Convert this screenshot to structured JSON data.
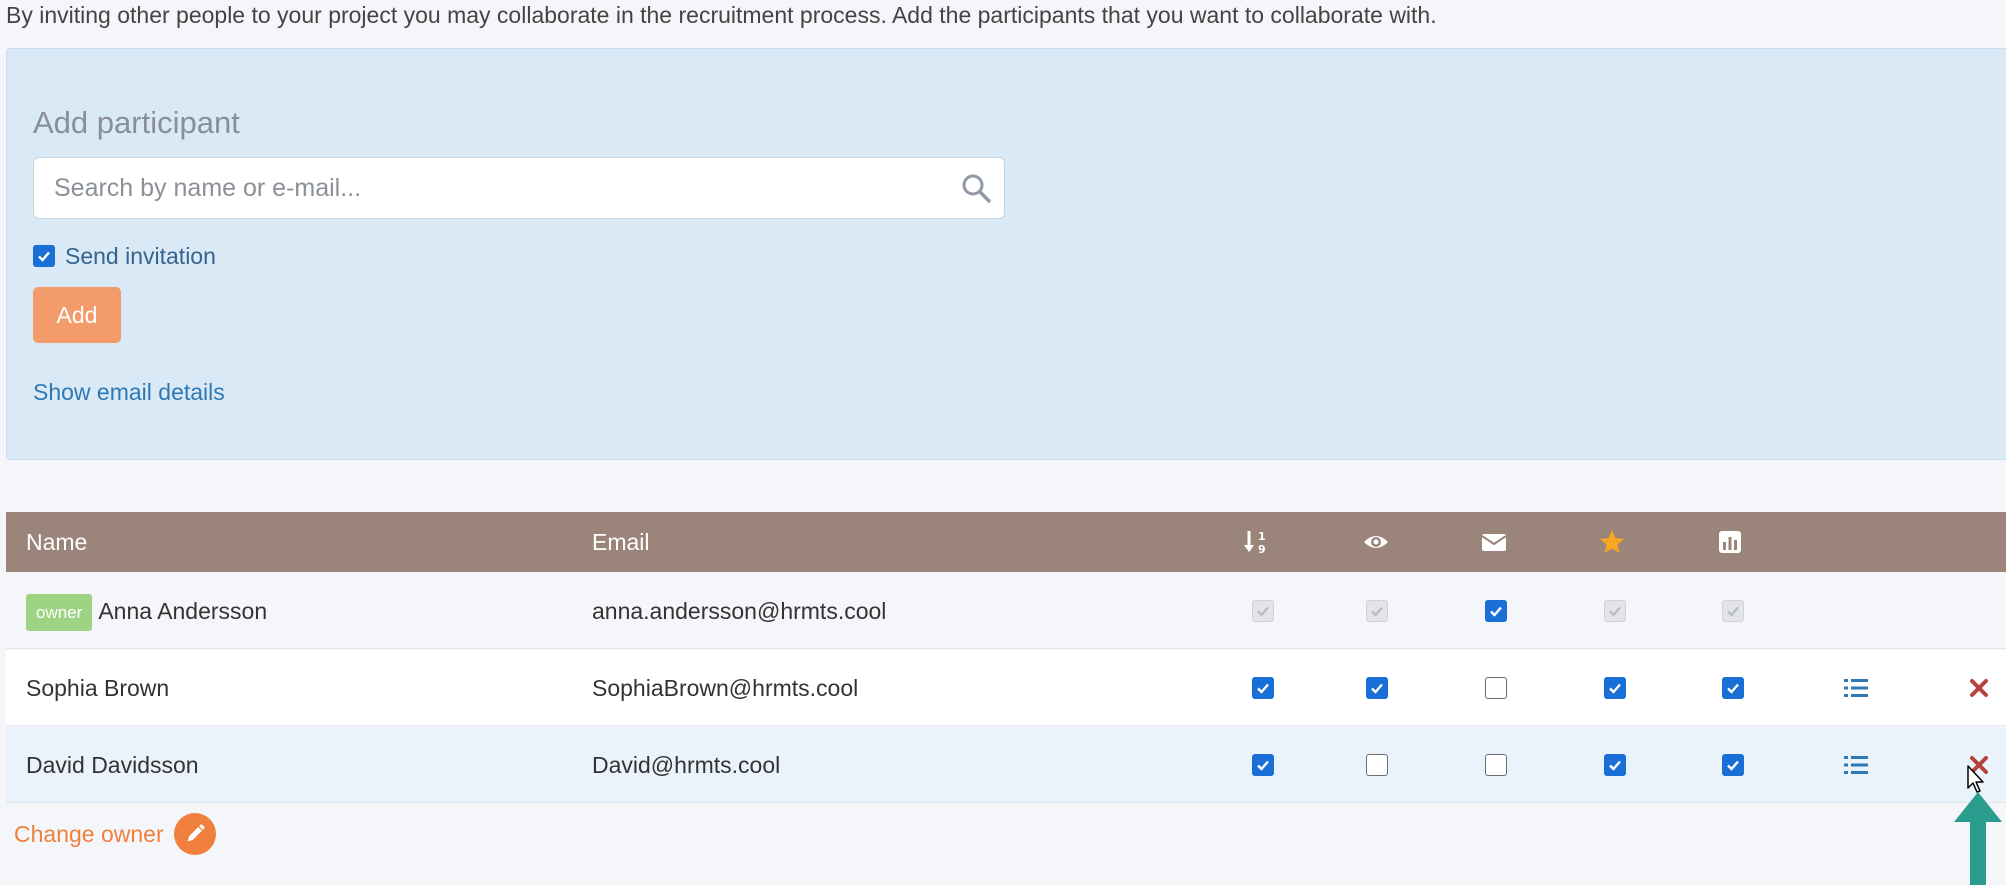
{
  "intro_text": "By inviting other people to your project you may collaborate in the recruitment process. Add the participants that you want to collaborate with.",
  "add_participant": {
    "title": "Add participant",
    "search_placeholder": "Search by name or e-mail...",
    "search_value": "",
    "send_invitation_label": "Send invitation",
    "send_invitation_checked": true,
    "add_button": "Add",
    "email_details_link": "Show email details"
  },
  "table": {
    "headers": {
      "name": "Name",
      "email": "Email",
      "icons": [
        "sort-numeric-icon",
        "eye-icon",
        "envelope-icon",
        "star-icon",
        "bar-chart-icon"
      ]
    },
    "rows": [
      {
        "badge": "owner",
        "name": "Anna Andersson",
        "email": "anna.andersson@hrmts.cool",
        "perms": [
          "disabled",
          "disabled",
          "checked",
          "disabled",
          "disabled"
        ],
        "actions": false
      },
      {
        "badge": "",
        "name": "Sophia Brown",
        "email": "SophiaBrown@hrmts.cool",
        "perms": [
          "checked",
          "checked",
          "unchecked",
          "checked",
          "checked"
        ],
        "actions": true
      },
      {
        "badge": "",
        "name": "David Davidsson",
        "email": "David@hrmts.cool",
        "perms": [
          "checked",
          "unchecked",
          "unchecked",
          "checked",
          "checked"
        ],
        "actions": true
      }
    ]
  },
  "change_owner_label": "Change owner",
  "colors": {
    "header_bg": "#9b857a",
    "panel_bg": "#d9eaf6",
    "accent_orange": "#ef7f3b",
    "add_button": "#f49b6c",
    "owner_badge": "#9ed383",
    "checkbox_blue": "#1a6fd6",
    "link_blue": "#2f78b4",
    "delete_red": "#b5433b",
    "annotation_arrow": "#2a9d8f"
  }
}
